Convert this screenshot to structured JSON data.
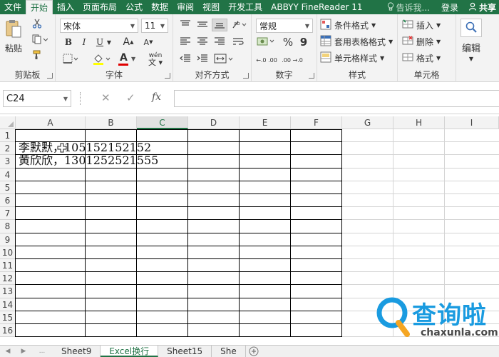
{
  "ribbon_tabs": [
    "文件",
    "开始",
    "插入",
    "页面布局",
    "公式",
    "数据",
    "审阅",
    "视图",
    "开发工具",
    "ABBYY FineReader 11"
  ],
  "active_tab": "开始",
  "tell_me": "告诉我...",
  "login": "登录",
  "share": "共享",
  "clipboard": {
    "paste": "粘贴",
    "label": "剪贴板"
  },
  "font": {
    "name": "宋体",
    "size": "11",
    "label": "字体",
    "bold": "B",
    "italic": "I",
    "underline": "U",
    "font_color_letter": "A",
    "grow": "A",
    "shrink": "A",
    "wen": "wén"
  },
  "alignment": {
    "label": "对齐方式"
  },
  "number": {
    "format": "常规",
    "percent": "%",
    "comma": "9",
    "label": "数字",
    "dec_inc": "←.0 .00",
    "dec_dec": ".00 →.0"
  },
  "styles": {
    "conditional": "条件格式",
    "table": "套用表格格式",
    "cell": "单元格样式",
    "label": "样式"
  },
  "cells": {
    "insert": "插入",
    "delete": "删除",
    "format": "格式",
    "label": "单元格"
  },
  "editing": {
    "label": "编辑"
  },
  "formula_bar": {
    "name_box": "C24",
    "fx": "fx",
    "formula": ""
  },
  "columns": [
    "A",
    "B",
    "C",
    "D",
    "E",
    "F",
    "G",
    "H",
    "I"
  ],
  "selected_column": "C",
  "rows": [
    "1",
    "2",
    "3",
    "4",
    "5",
    "6",
    "7",
    "8",
    "9",
    "10",
    "11",
    "12",
    "13",
    "14",
    "15",
    "16"
  ],
  "cells_data": {
    "A2": "李默默，105152152152",
    "A3": "黄欣欣，1301252521555"
  },
  "sheet_tabs": [
    "Sheet9",
    "Excel换行",
    "Sheet15",
    "She"
  ],
  "active_sheet": "Excel换行",
  "watermark": {
    "cn": "查询啦",
    "en": "chaxunla.com"
  },
  "colors": {
    "excel_green": "#217346",
    "ribbon_bg": "#f3f3f3",
    "watermark_blue": "#1a9be0"
  }
}
